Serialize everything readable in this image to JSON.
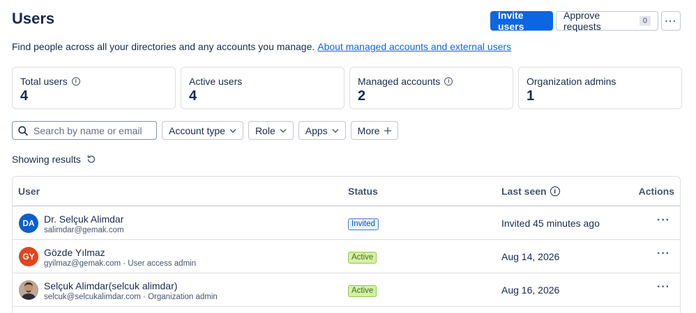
{
  "page": {
    "title": "Users",
    "description": "Find people across all your directories and any accounts you manage.",
    "description_link": "About managed accounts and external users"
  },
  "header_actions": {
    "invite_label": "Invite users",
    "approve_label": "Approve requests",
    "approve_count": "0",
    "more_label": "···"
  },
  "stats": [
    {
      "label": "Total users",
      "value": "4",
      "info": true
    },
    {
      "label": "Active users",
      "value": "4",
      "info": false
    },
    {
      "label": "Managed accounts",
      "value": "2",
      "info": true
    },
    {
      "label": "Organization admins",
      "value": "1",
      "info": false
    }
  ],
  "filters": {
    "search_placeholder": "Search by name or email",
    "account_type": "Account type",
    "role": "Role",
    "apps": "Apps",
    "more": "More"
  },
  "results": {
    "label": "Showing results"
  },
  "table": {
    "columns": {
      "user": "User",
      "status": "Status",
      "last_seen": "Last seen",
      "actions": "Actions"
    },
    "rows": [
      {
        "initials": "DA",
        "avatar_color": "#0c5fce",
        "name": "Dr. Selçuk Alimdar",
        "sub": "salimdar@gemak.com",
        "status": "Invited",
        "status_kind": "invited",
        "last_seen": "Invited 45 minutes ago"
      },
      {
        "initials": "GY",
        "avatar_color": "#e3441f",
        "name": "Gözde Yılmaz",
        "sub": "gyilmaz@gemak.com · User access admin",
        "status": "Active",
        "status_kind": "active",
        "last_seen": "Aug 14, 2026"
      },
      {
        "initials": "",
        "avatar_color": "#8a5a44",
        "name": "Selçuk Alimdar(selcuk alimdar)",
        "sub": "selcuk@selcukalimdar.com · Organization admin",
        "status": "Active",
        "status_kind": "active",
        "last_seen": "Aug 16, 2026"
      }
    ],
    "row_action_label": "···"
  }
}
